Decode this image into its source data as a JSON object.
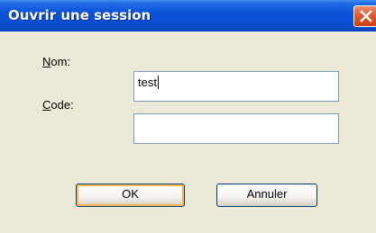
{
  "window": {
    "title": "Ouvrir une session"
  },
  "form": {
    "nom_label_accel": "N",
    "nom_label_rest": "om:",
    "nom_value": "test",
    "code_label_accel": "C",
    "code_label_rest": "ode:",
    "code_value": ""
  },
  "buttons": {
    "ok_label": "OK",
    "cancel_label": "Annuler"
  },
  "icons": {
    "close": "close-icon"
  },
  "colors": {
    "titlebar": "#0a52d6",
    "client_background": "#ece9d8",
    "close_button": "#e05a2c",
    "field_border": "#7f9db9",
    "default_button_highlight": "#f4b23c"
  }
}
